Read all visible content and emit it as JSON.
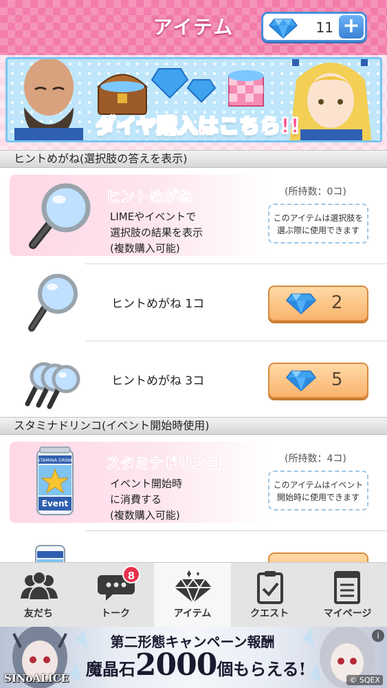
{
  "header": {
    "title": "アイテム",
    "gem_count": "11",
    "plus_label": "+"
  },
  "banner": {
    "text": "ダイヤ購入はこちら!!"
  },
  "sections": [
    {
      "title": "ヒントめがね(選択肢の答えを表示)",
      "item": {
        "name": "ヒントめがね",
        "desc1": "LIMEやイベントで",
        "desc2": "選択肢の結果を表示",
        "desc3": "(複数購入可能)",
        "owned": "(所持数：0コ)",
        "note1": "このアイテムは選択肢を",
        "note2": "選ぶ際に使用できます"
      },
      "offers": [
        {
          "label": "ヒントめがね 1コ",
          "price": "2"
        },
        {
          "label": "ヒントめがね 3コ",
          "price": "5"
        }
      ]
    },
    {
      "title": "スタミナドリンコ(イベント開始時使用)",
      "item": {
        "name": "スタミナドリンコ",
        "desc1": "イベント開始時",
        "desc2": "に消費する",
        "desc3": "(複数購入可能)",
        "owned": "(所持数：4コ)",
        "note1": "このアイテムはイベント",
        "note2": "開始時に使用できます",
        "can_label_top": "STAMINA DRINK",
        "can_label_bottom": "Event"
      }
    }
  ],
  "nav": {
    "items": [
      {
        "label": "友だち",
        "icon": "friends-icon"
      },
      {
        "label": "トーク",
        "icon": "chat-icon",
        "badge": "8"
      },
      {
        "label": "アイテム",
        "icon": "diamond-icon",
        "active": true
      },
      {
        "label": "クエスト",
        "icon": "clipboard-icon"
      },
      {
        "label": "マイページ",
        "icon": "document-icon"
      }
    ]
  },
  "ad": {
    "headline": "第二形態キャンペーン報酬",
    "reward_pre": "魔晶石",
    "reward_num": "2000",
    "reward_post": "個もらえる!",
    "brand": "SINoALICE",
    "copyright": "© SQEX",
    "info": "i"
  },
  "colors": {
    "header_pink": "#f37cab",
    "gem_blue": "#3b82d6",
    "price_orange": "#f9b46d",
    "name_pink": "#ff5fa0"
  }
}
